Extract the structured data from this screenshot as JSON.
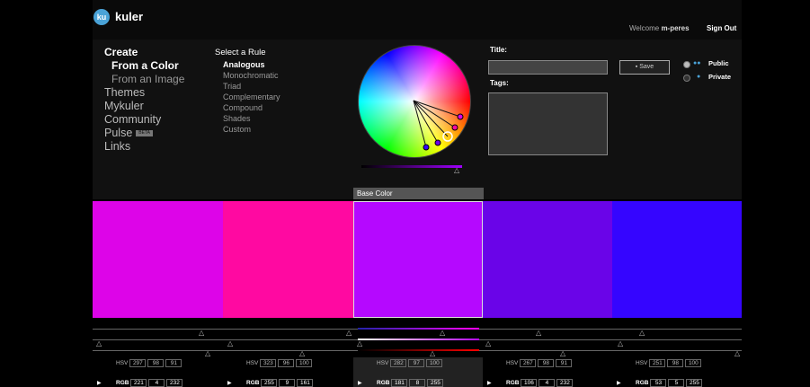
{
  "brand": {
    "logo_mark": "ku",
    "name": "kuler"
  },
  "header": {
    "welcome_prefix": "Welcome",
    "username": "m-peres",
    "signout": "Sign Out"
  },
  "nav": {
    "create": "Create",
    "from_color": "From a Color",
    "from_image": "From an Image",
    "themes": "Themes",
    "mykuler": "Mykuler",
    "community": "Community",
    "pulse": "Pulse",
    "pulse_badge": "BETA",
    "links": "Links"
  },
  "rules": {
    "title": "Select a Rule",
    "items": [
      "Analogous",
      "Monochromatic",
      "Triad",
      "Complementary",
      "Compound",
      "Shades",
      "Custom"
    ],
    "active": "Analogous"
  },
  "form": {
    "title_label": "Title:",
    "tags_label": "Tags:",
    "save_label": "Save",
    "public_label": "Public",
    "private_label": "Private",
    "visibility": "Public"
  },
  "base_color_label": "Base Color",
  "swatches": [
    {
      "color": "#dd04e8",
      "hsv": [
        "297",
        "98",
        "91"
      ],
      "rgb": [
        "221",
        "4",
        "232"
      ]
    },
    {
      "color": "#ff09a1",
      "hsv": [
        "323",
        "96",
        "100"
      ],
      "rgb": [
        "255",
        "9",
        "161"
      ]
    },
    {
      "color": "#b508ff",
      "hsv": [
        "282",
        "97",
        "100"
      ],
      "rgb": [
        "181",
        "8",
        "255"
      ],
      "selected": true
    },
    {
      "color": "#6a04e8",
      "hsv": [
        "267",
        "98",
        "91"
      ],
      "rgb": [
        "106",
        "4",
        "232"
      ]
    },
    {
      "color": "#3505ff",
      "hsv": [
        "251",
        "98",
        "100"
      ],
      "rgb": [
        "53",
        "5",
        "255"
      ]
    }
  ],
  "labels": {
    "hsv": "HSV",
    "rgb": "RGB"
  },
  "icons": {
    "save": "disk-icon",
    "public": "group-icon",
    "private": "person-icon",
    "play": "play-icon",
    "slider_handle": "triangle-icon"
  }
}
